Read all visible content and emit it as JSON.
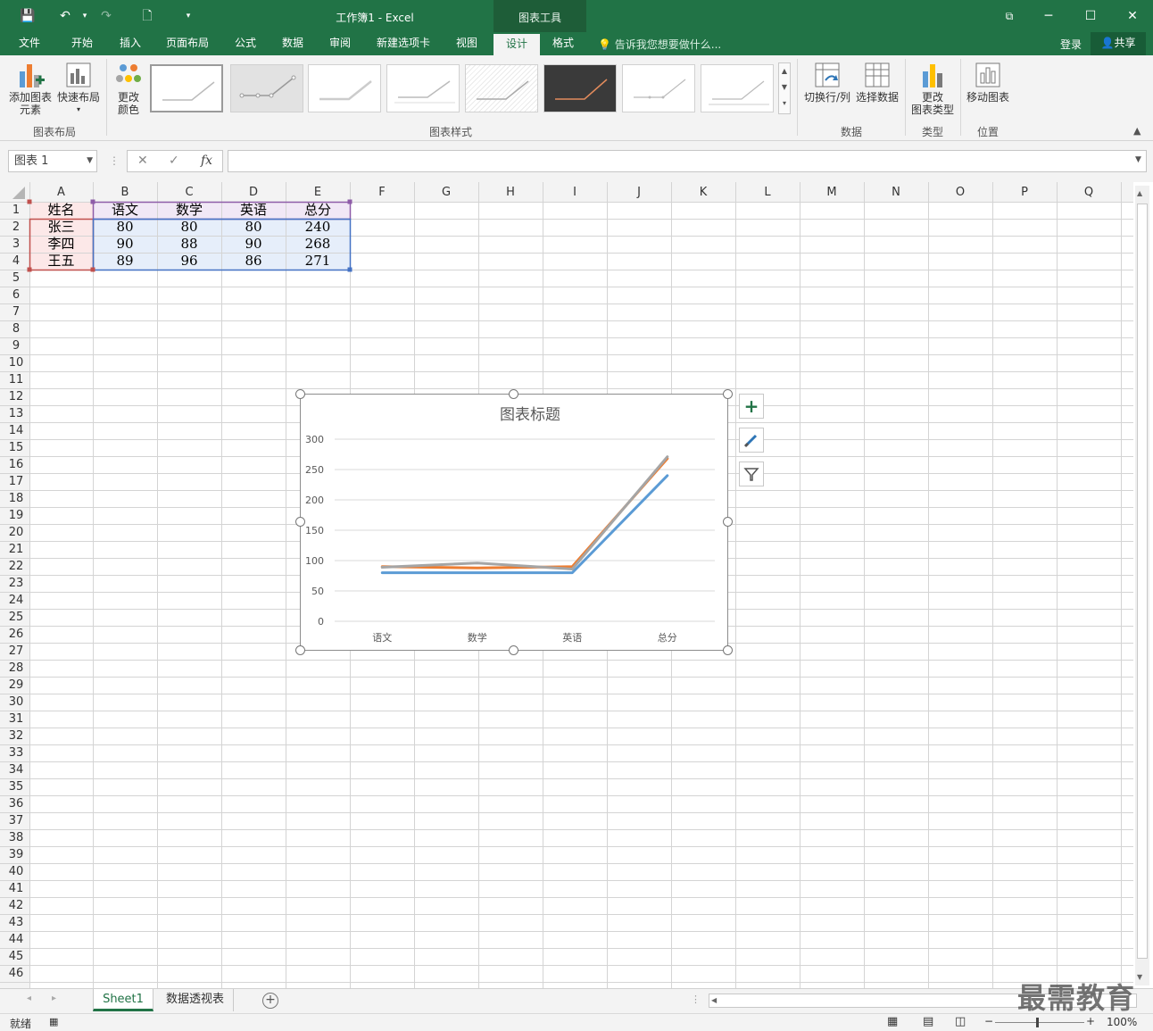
{
  "titlebar": {
    "title": "工作簿1 - Excel",
    "context_tools": "图表工具"
  },
  "tabs": [
    "文件",
    "开始",
    "插入",
    "页面布局",
    "公式",
    "数据",
    "审阅",
    "新建选项卡",
    "视图",
    "设计",
    "格式"
  ],
  "active_tab": "设计",
  "tell_me": "告诉我您想要做什么...",
  "login": "登录",
  "share": "共享",
  "ribbon": {
    "add_element": [
      "添加图表",
      "元素"
    ],
    "quick_layout": "快速布局",
    "change_color": [
      "更改",
      "颜色"
    ],
    "switch_row_col": "切换行/列",
    "select_data": "选择数据",
    "change_type": [
      "更改",
      "图表类型"
    ],
    "move_chart": "移动图表",
    "groups": {
      "layouts": "图表布局",
      "styles": "图表样式",
      "data": "数据",
      "type": "类型",
      "location": "位置"
    }
  },
  "formula_bar": {
    "name_box": "图表 1",
    "cancel_glyph": "✕",
    "enter_glyph": "✓",
    "fx_glyph": "fx",
    "value": ""
  },
  "sheet": {
    "columns": [
      "A",
      "B",
      "C",
      "D",
      "E",
      "F",
      "G",
      "H",
      "I",
      "J",
      "K",
      "L",
      "M",
      "N",
      "O",
      "P",
      "Q"
    ],
    "rows": [
      "1",
      "2",
      "3",
      "4",
      "5",
      "6",
      "7",
      "8",
      "9",
      "10",
      "11",
      "12",
      "13",
      "14",
      "15",
      "16",
      "17",
      "18",
      "19",
      "20",
      "21",
      "22",
      "23",
      "24",
      "25",
      "26",
      "27",
      "28",
      "29",
      "30",
      "31",
      "32",
      "33",
      "34",
      "35",
      "36",
      "37",
      "38",
      "39",
      "40",
      "41",
      "42",
      "43",
      "44",
      "45",
      "46"
    ],
    "cells": [
      [
        "姓名",
        "语文",
        "数学",
        "英语",
        "总分"
      ],
      [
        "张三",
        "80",
        "80",
        "80",
        "240"
      ],
      [
        "李四",
        "90",
        "88",
        "90",
        "268"
      ],
      [
        "王五",
        "89",
        "96",
        "86",
        "271"
      ]
    ]
  },
  "chart_data": {
    "type": "line",
    "title": "图表标题",
    "categories": [
      "语文",
      "数学",
      "英语",
      "总分"
    ],
    "series": [
      {
        "values": [
          80,
          80,
          80,
          240
        ],
        "color": "#5b9bd5"
      },
      {
        "values": [
          90,
          88,
          90,
          268
        ],
        "color": "#ed7d31"
      },
      {
        "values": [
          89,
          96,
          86,
          271
        ],
        "color": "#a5a5a5"
      }
    ],
    "ylim": [
      0,
      300
    ],
    "yticks": [
      "0",
      "50",
      "100",
      "150",
      "200",
      "250",
      "300"
    ],
    "grid": true,
    "legend": "none"
  },
  "sheet_tabs": [
    "Sheet1",
    "数据透视表"
  ],
  "status": {
    "ready": "就绪",
    "zoom": "100%"
  },
  "watermark": "最需教育"
}
